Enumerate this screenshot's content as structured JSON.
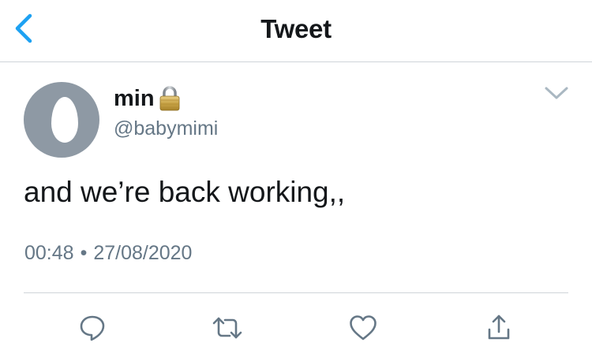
{
  "header": {
    "title": "Tweet",
    "back_icon": "chevron-left-icon"
  },
  "tweet": {
    "author": {
      "name": "min",
      "handle": "@babymimi",
      "protected_icon": "lock-icon",
      "avatar": "default-egg-avatar"
    },
    "text": "and we’re back working,,",
    "time": "00:48",
    "separator": "•",
    "date": "27/08/2020"
  },
  "actions": [
    {
      "name": "reply",
      "icon": "reply-icon"
    },
    {
      "name": "retweet",
      "icon": "retweet-icon"
    },
    {
      "name": "like",
      "icon": "heart-icon"
    },
    {
      "name": "share",
      "icon": "share-icon"
    }
  ],
  "colors": {
    "accent": "#1da1f2",
    "text": "#14171a",
    "secondary": "#657786",
    "divider": "#cfd4d9",
    "avatar_bg": "#8e99a4"
  }
}
